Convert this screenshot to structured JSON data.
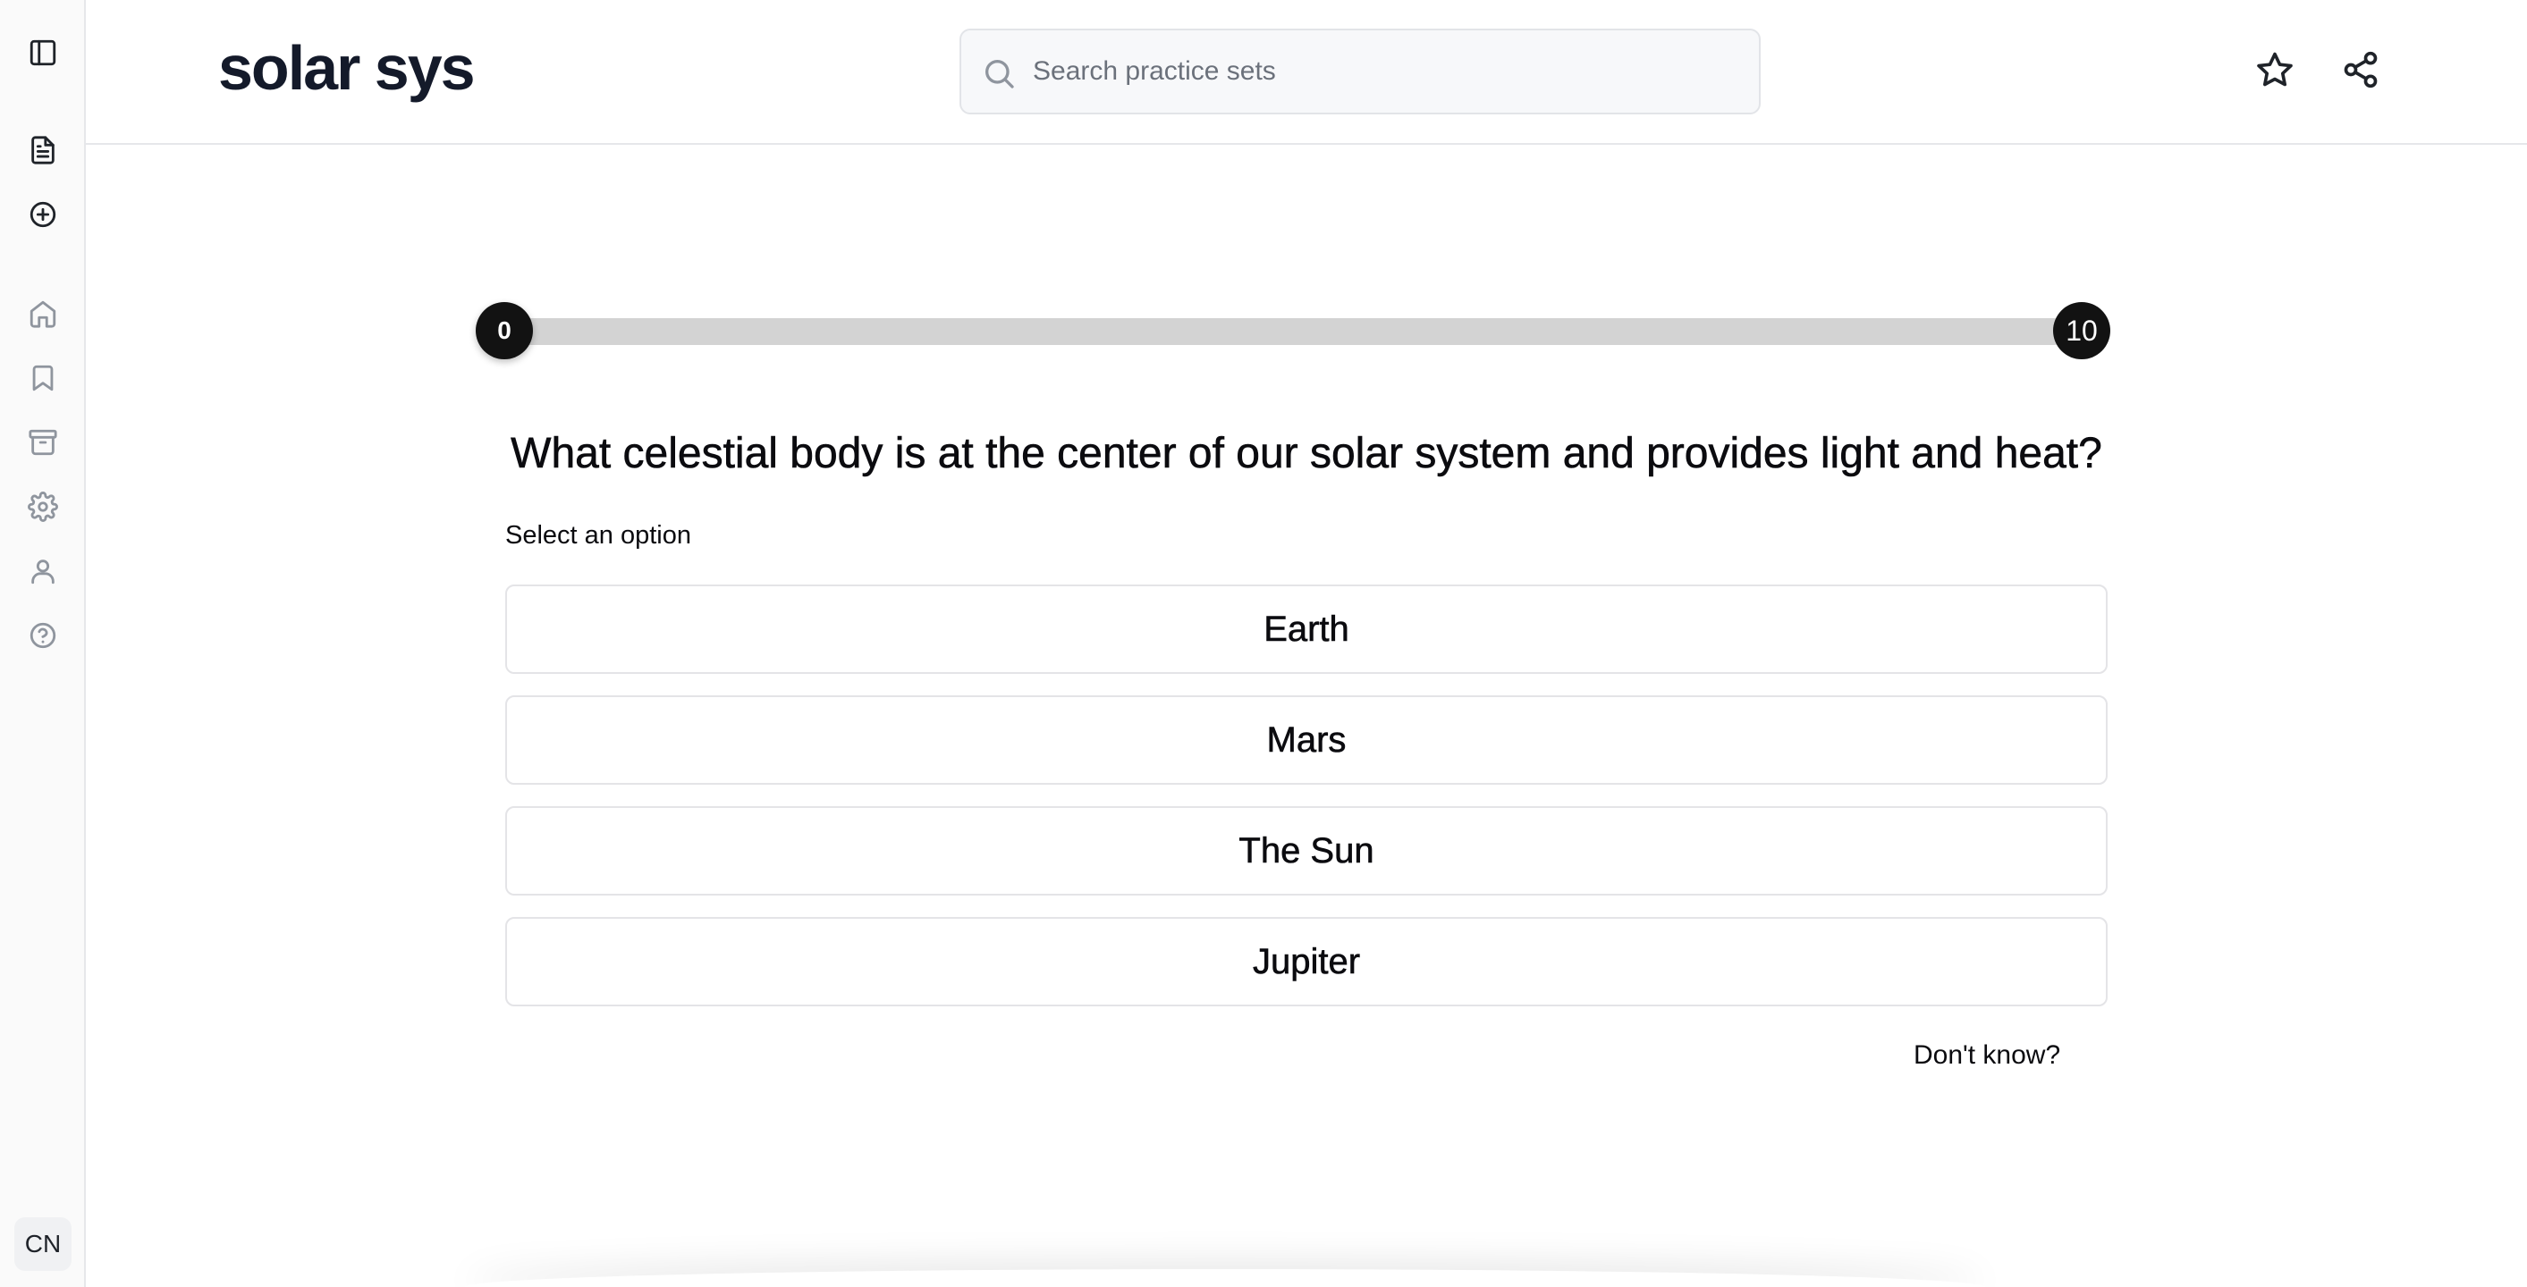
{
  "app": {
    "title": "solar sys"
  },
  "search": {
    "placeholder": "Search practice sets"
  },
  "sidebar": {
    "top_icons": [
      "sidebar-toggle-icon"
    ],
    "primary_icons": [
      "document-icon",
      "add-circle-icon"
    ],
    "nav_icons": [
      "home-icon",
      "bookmark-icon",
      "archive-icon",
      "gear-icon",
      "user-icon",
      "help-icon"
    ],
    "avatar_initials": "CN"
  },
  "header_actions": [
    "star-icon",
    "share-icon"
  ],
  "progress": {
    "current": 0,
    "total": 10,
    "start_label": "0",
    "end_label": "10"
  },
  "quiz": {
    "question": "What celestial body is at the center of our solar system and provides light and heat?",
    "prompt": "Select an option",
    "options": [
      "Earth",
      "Mars",
      "The Sun",
      "Jupiter"
    ],
    "dont_know_label": "Don't know?"
  },
  "colors": {
    "accent_dark": "#121212",
    "track": "#d3d3d3",
    "sidebar_bg": "#fafafa",
    "border": "#e4e4e7"
  }
}
